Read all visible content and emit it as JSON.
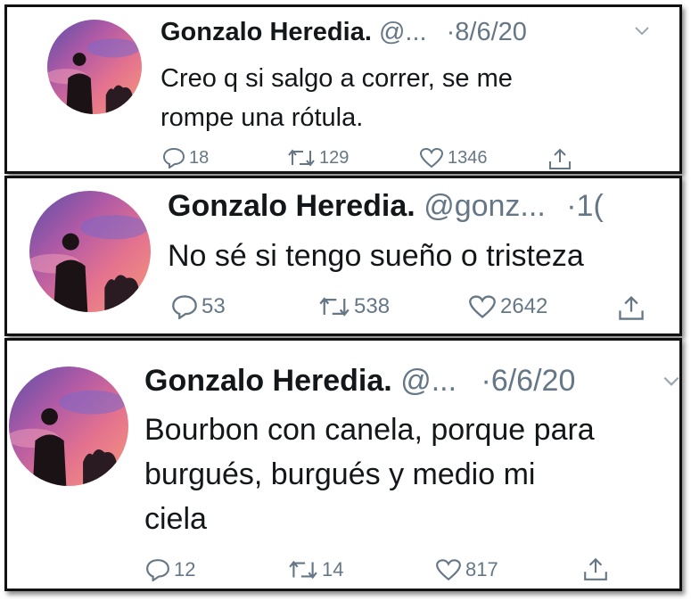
{
  "tweets": [
    {
      "name": "Gonzalo Heredia.",
      "handle": "@...",
      "date": "·8/6/20",
      "text_lines": [
        "Creo q si salgo a correr, se me",
        "rompe una rótula."
      ],
      "replies": "18",
      "retweets": "129",
      "likes": "1346"
    },
    {
      "name": "Gonzalo Heredia.",
      "handle": "@gonz...",
      "date": "·1(",
      "text_lines": [
        "No sé si tengo sueño o tristeza"
      ],
      "replies": "53",
      "retweets": "538",
      "likes": "2642"
    },
    {
      "name": "Gonzalo Heredia.",
      "handle": "@...",
      "date": "·6/6/20",
      "text_lines": [
        "Bourbon con canela, porque para",
        "burgués, burgués y medio mi",
        "ciela"
      ],
      "replies": "12",
      "retweets": "14",
      "likes": "817"
    }
  ],
  "icons": {
    "reply": "reply-icon",
    "retweet": "retweet-icon",
    "like": "heart-icon",
    "share": "share-icon",
    "chevron": "chevron-down-icon"
  },
  "colors": {
    "text": "#14171a",
    "muted": "#657786",
    "frame": "#111111"
  }
}
